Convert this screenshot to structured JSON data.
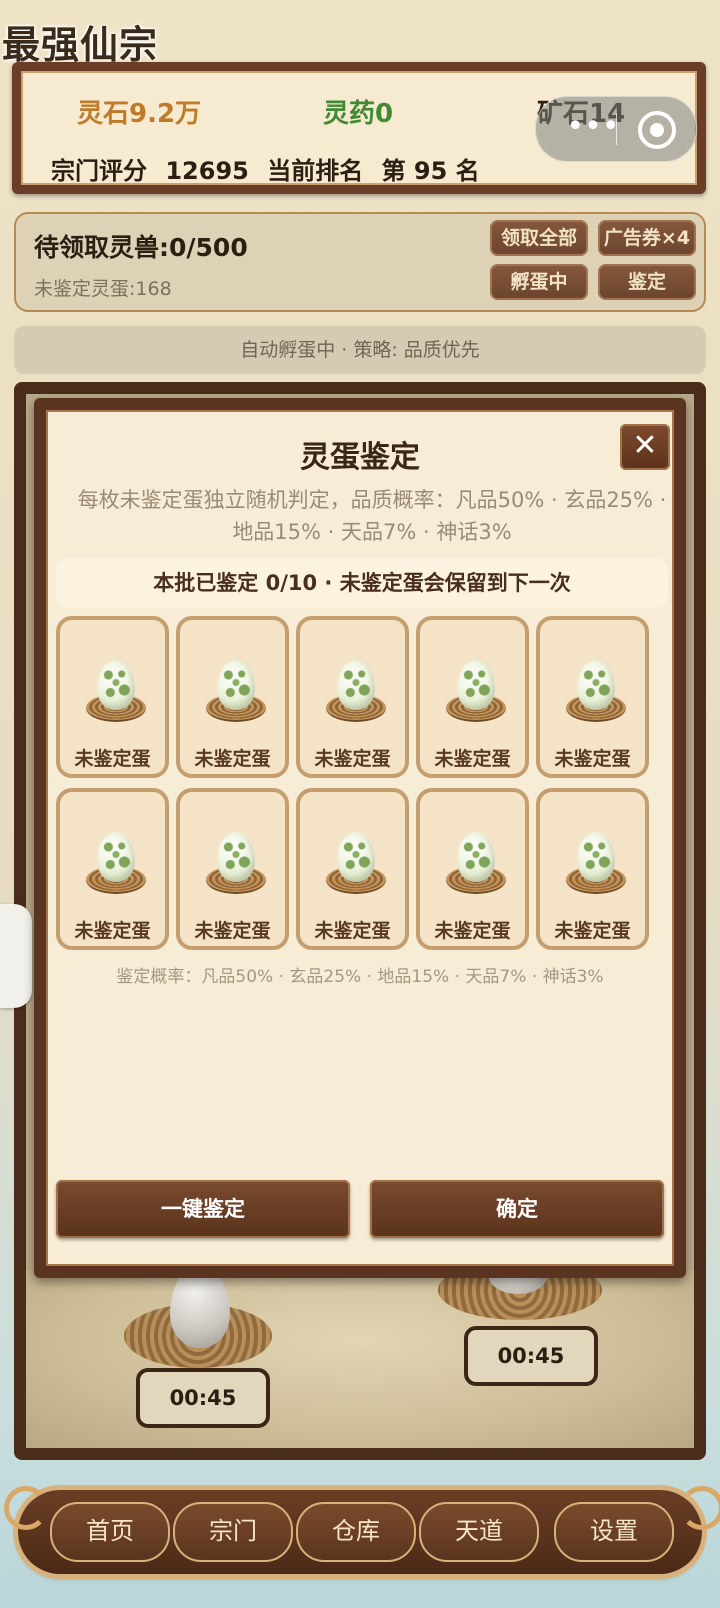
{
  "app": {
    "title": "最强仙宗"
  },
  "resources": {
    "spirit_stone": "灵石9.2万",
    "spirit_medicine": "灵药0",
    "ore": "矿石14",
    "score_label": "宗门评分",
    "score_value": "12695",
    "rank_label": "当前排名",
    "rank_value": "第 95 名",
    "colors": {
      "spirit_stone": "#c07a2a",
      "spirit_medicine": "#3f8a33",
      "ore": "#2c1e12"
    }
  },
  "capsule": {
    "more": "•••"
  },
  "beast_panel": {
    "pending": "待领取灵兽:0/500",
    "unidentified": "未鉴定灵蛋:168",
    "claim_all": "领取全部",
    "ad_ticket": "广告券×4",
    "hatching": "孵蛋中",
    "identify": "鉴定"
  },
  "auto_status": "自动孵蛋中 · 策略: 品质优先",
  "incubator": {
    "timer_left": "00:45",
    "timer_right": "00:45"
  },
  "modal": {
    "title": "灵蛋鉴定",
    "close": "✕",
    "description": "每枚未鉴定蛋独立随机判定，品质概率：凡品50% · 玄品25% · 地品15% · 天品7% · 神话3%",
    "batch_status": "本批已鉴定 0/10 · 未鉴定蛋会保留到下一次",
    "eggs": [
      {
        "label": "未鉴定蛋"
      },
      {
        "label": "未鉴定蛋"
      },
      {
        "label": "未鉴定蛋"
      },
      {
        "label": "未鉴定蛋"
      },
      {
        "label": "未鉴定蛋"
      },
      {
        "label": "未鉴定蛋"
      },
      {
        "label": "未鉴定蛋"
      },
      {
        "label": "未鉴定蛋"
      },
      {
        "label": "未鉴定蛋"
      },
      {
        "label": "未鉴定蛋"
      }
    ],
    "probability_line": "鉴定概率：凡品50% · 玄品25% · 地品15% · 天品7% · 神话3%",
    "one_click_identify": "一键鉴定",
    "confirm": "确定"
  },
  "nav": {
    "items": [
      {
        "label": "首页"
      },
      {
        "label": "宗门"
      },
      {
        "label": "仓库"
      },
      {
        "label": "天道"
      },
      {
        "label": "设置"
      }
    ]
  }
}
